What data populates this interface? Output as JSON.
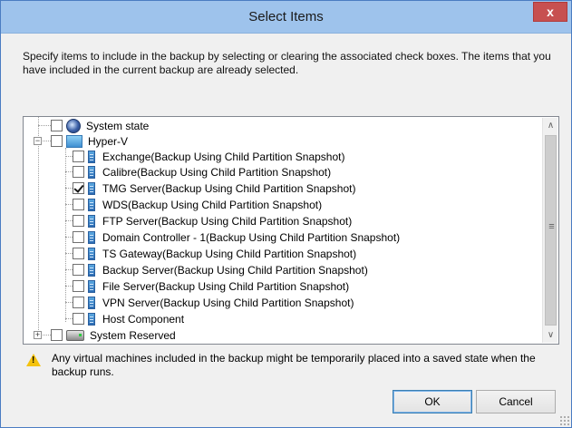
{
  "window": {
    "title": "Select Items",
    "close_label": "x"
  },
  "description": "Specify items to include in the backup by selecting or clearing the associated check boxes. The items that you have included in the current backup are already selected.",
  "tree": {
    "system_state": {
      "label": "System state",
      "checked": false
    },
    "hyperv": {
      "label": "Hyper-V",
      "checked": false,
      "expander": "⊟"
    },
    "children": [
      {
        "label": "Exchange(Backup Using Child Partition Snapshot)",
        "checked": false
      },
      {
        "label": "Calibre(Backup Using Child Partition Snapshot)",
        "checked": false
      },
      {
        "label": "TMG Server(Backup Using Child Partition Snapshot)",
        "checked": true
      },
      {
        "label": "WDS(Backup Using Child Partition Snapshot)",
        "checked": false
      },
      {
        "label": "FTP Server(Backup Using Child Partition Snapshot)",
        "checked": false
      },
      {
        "label": "Domain Controller - 1(Backup Using Child Partition Snapshot)",
        "checked": false
      },
      {
        "label": "TS Gateway(Backup Using Child Partition Snapshot)",
        "checked": false
      },
      {
        "label": "Backup Server(Backup Using Child Partition Snapshot)",
        "checked": false
      },
      {
        "label": "File Server(Backup Using Child Partition Snapshot)",
        "checked": false
      },
      {
        "label": "VPN Server(Backup Using Child Partition Snapshot)",
        "checked": false
      },
      {
        "label": "Host Component",
        "checked": false
      }
    ],
    "system_reserved": {
      "label": "System Reserved",
      "checked": false,
      "expander": "⊞"
    }
  },
  "scrollbar": {
    "up_icon": "chevron-up-icon",
    "down_icon": "chevron-down-icon",
    "grip_icon": "grip-icon"
  },
  "warning": {
    "icon": "warning-icon",
    "text": "Any virtual machines included in the backup might be temporarily placed into a saved state when the backup runs."
  },
  "buttons": {
    "ok": "OK",
    "cancel": "Cancel"
  },
  "colors": {
    "titlebar": "#9ec3ec",
    "close": "#c75050",
    "warning": "#f4c20d"
  }
}
